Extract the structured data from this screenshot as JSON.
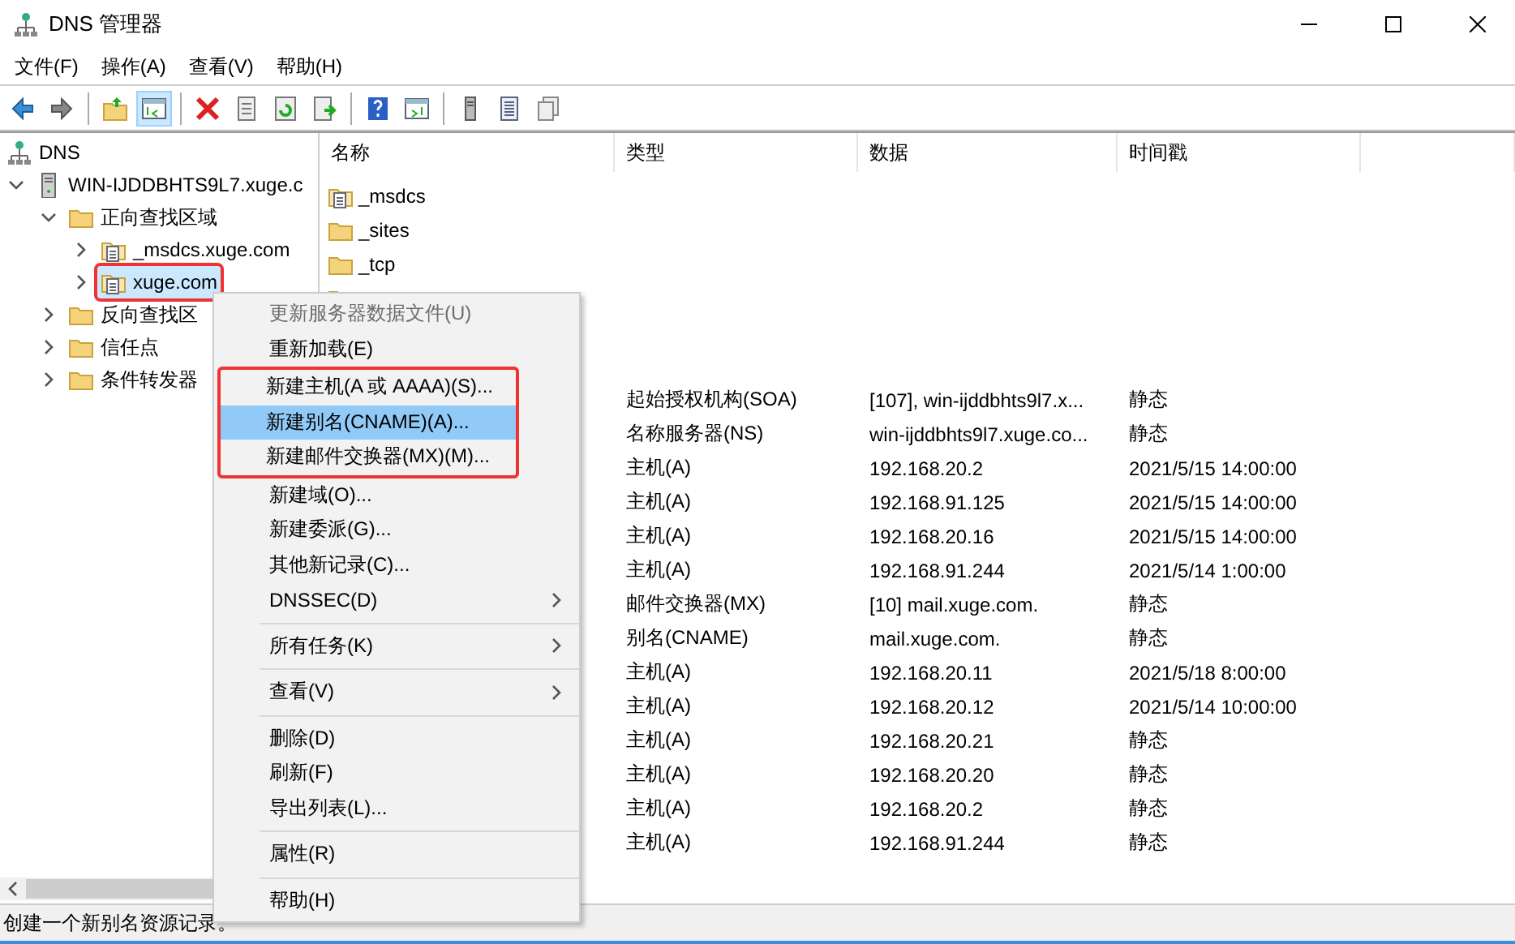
{
  "window": {
    "title": "DNS 管理器"
  },
  "menu_bar": [
    "文件(F)",
    "操作(A)",
    "查看(V)",
    "帮助(H)"
  ],
  "toolbar": [
    {
      "kind": "back",
      "pressed": false
    },
    {
      "kind": "forward",
      "pressed": false
    },
    {
      "kind": "sep"
    },
    {
      "kind": "up",
      "pressed": false
    },
    {
      "kind": "pane",
      "pressed": true
    },
    {
      "kind": "sep"
    },
    {
      "kind": "delete",
      "pressed": false
    },
    {
      "kind": "props",
      "pressed": false
    },
    {
      "kind": "refresh",
      "pressed": false
    },
    {
      "kind": "export",
      "pressed": false
    },
    {
      "kind": "sep"
    },
    {
      "kind": "help",
      "pressed": false
    },
    {
      "kind": "view",
      "pressed": false
    },
    {
      "kind": "sep"
    },
    {
      "kind": "server",
      "pressed": false
    },
    {
      "kind": "list",
      "pressed": false
    },
    {
      "kind": "copy",
      "pressed": false
    }
  ],
  "tree": [
    {
      "label": "DNS",
      "kind": "dns",
      "selected": false,
      "boxed": false,
      "children": [
        {
          "label": "WIN-IJDDBHTS9L7.xuge.c",
          "kind": "server",
          "expanded": true,
          "selected": false,
          "boxed": false,
          "children": [
            {
              "label": "正向查找区域",
              "kind": "folder",
              "expanded": true,
              "selected": false,
              "boxed": false,
              "children": [
                {
                  "label": "_msdcs.xuge.com",
                  "kind": "zone",
                  "expanded": false,
                  "selected": false,
                  "boxed": false
                },
                {
                  "label": "xuge.com",
                  "kind": "zone",
                  "expanded": false,
                  "selected": true,
                  "boxed": true
                }
              ]
            },
            {
              "label": "反向查找区",
              "kind": "folder",
              "expanded": false,
              "selected": false,
              "boxed": false
            },
            {
              "label": "信任点",
              "kind": "folder",
              "expanded": false,
              "selected": false,
              "boxed": false
            },
            {
              "label": "条件转发器",
              "kind": "folder",
              "expanded": false,
              "selected": false,
              "boxed": false
            }
          ]
        }
      ]
    }
  ],
  "list": {
    "columns": [
      "名称",
      "类型",
      "数据",
      "时间戳"
    ],
    "rows": [
      {
        "kind": "zone",
        "name": "_msdcs"
      },
      {
        "kind": "folder",
        "name": "_sites"
      },
      {
        "kind": "folder",
        "name": "_tcp"
      },
      {
        "kind": "folder"
      },
      {},
      {},
      {
        "type": "起始授权机构(SOA)",
        "data": "[107], win-ijddbhts9l7.x...",
        "timestamp": "静态"
      },
      {
        "type": "名称服务器(NS)",
        "data": "win-ijddbhts9l7.xuge.co...",
        "timestamp": "静态"
      },
      {
        "type": "主机(A)",
        "data": "192.168.20.2",
        "timestamp": "2021/5/15 14:00:00"
      },
      {
        "type": "主机(A)",
        "data": "192.168.91.125",
        "timestamp": "2021/5/15 14:00:00"
      },
      {
        "type": "主机(A)",
        "data": "192.168.20.16",
        "timestamp": "2021/5/15 14:00:00"
      },
      {
        "type": "主机(A)",
        "data": "192.168.91.244",
        "timestamp": "2021/5/14 1:00:00"
      },
      {
        "type": "邮件交换器(MX)",
        "data": "[10]  mail.xuge.com.",
        "timestamp": "静态"
      },
      {
        "type": "别名(CNAME)",
        "data": "mail.xuge.com.",
        "timestamp": "静态"
      },
      {
        "type": "主机(A)",
        "data": "192.168.20.11",
        "timestamp": "2021/5/18 8:00:00"
      },
      {
        "type": "主机(A)",
        "data": "192.168.20.12",
        "timestamp": "2021/5/14 10:00:00"
      },
      {
        "type": "主机(A)",
        "data": "192.168.20.21",
        "timestamp": "静态"
      },
      {
        "type": "主机(A)",
        "data": "192.168.20.20",
        "timestamp": "静态"
      },
      {
        "type": "主机(A)",
        "data": "192.168.20.2",
        "timestamp": "静态"
      },
      {
        "type": "主机(A)",
        "data": "192.168.91.244",
        "timestamp": "静态"
      }
    ]
  },
  "context_menu": [
    [
      {
        "label": "更新服务器数据文件(U)",
        "disabled": true,
        "selected": false,
        "boxed": false,
        "submenu": false
      },
      {
        "label": "重新加载(E)",
        "disabled": false,
        "selected": false,
        "boxed": false,
        "submenu": false
      },
      {
        "label": "新建主机(A 或 AAAA)(S)...",
        "disabled": false,
        "selected": false,
        "boxed": true,
        "submenu": false
      },
      {
        "label": "新建别名(CNAME)(A)...",
        "disabled": false,
        "selected": true,
        "boxed": true,
        "submenu": false
      },
      {
        "label": "新建邮件交换器(MX)(M)...",
        "disabled": false,
        "selected": false,
        "boxed": true,
        "submenu": false
      },
      {
        "label": "新建域(O)...",
        "disabled": false,
        "selected": false,
        "boxed": false,
        "submenu": false
      },
      {
        "label": "新建委派(G)...",
        "disabled": false,
        "selected": false,
        "boxed": false,
        "submenu": false
      },
      {
        "label": "其他新记录(C)...",
        "disabled": false,
        "selected": false,
        "boxed": false,
        "submenu": false
      },
      {
        "label": "DNSSEC(D)",
        "disabled": false,
        "selected": false,
        "boxed": false,
        "submenu": true
      }
    ],
    [
      {
        "label": "所有任务(K)",
        "disabled": false,
        "selected": false,
        "boxed": false,
        "submenu": true
      }
    ],
    [
      {
        "label": "查看(V)",
        "disabled": false,
        "selected": false,
        "boxed": false,
        "submenu": true
      }
    ],
    [
      {
        "label": "删除(D)",
        "disabled": false,
        "selected": false,
        "boxed": false,
        "submenu": false
      },
      {
        "label": "刷新(F)",
        "disabled": false,
        "selected": false,
        "boxed": false,
        "submenu": false
      },
      {
        "label": "导出列表(L)...",
        "disabled": false,
        "selected": false,
        "boxed": false,
        "submenu": false
      }
    ],
    [
      {
        "label": "属性(R)",
        "disabled": false,
        "selected": false,
        "boxed": false,
        "submenu": false
      }
    ],
    [
      {
        "label": "帮助(H)",
        "disabled": false,
        "selected": false,
        "boxed": false,
        "submenu": false
      }
    ]
  ],
  "status_bar": "创建一个新别名资源记录。"
}
